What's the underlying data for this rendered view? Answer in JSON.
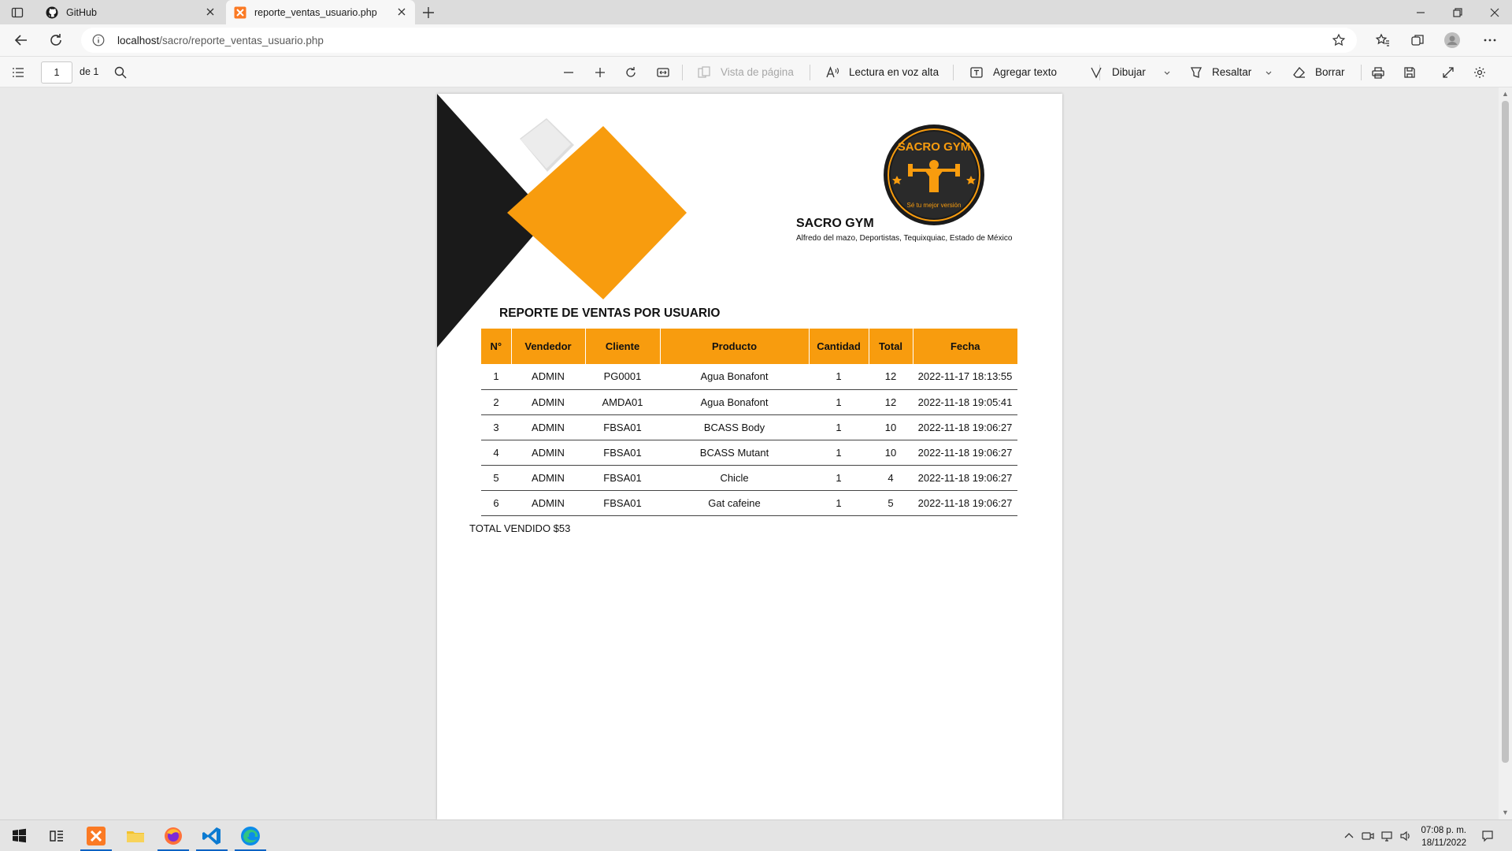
{
  "browser": {
    "tabs": [
      {
        "title": "GitHub",
        "favicon": "github-icon"
      },
      {
        "title": "reporte_ventas_usuario.php",
        "favicon": "xampp-icon"
      }
    ],
    "url_host": "localhost",
    "url_path": "/sacro/reporte_ventas_usuario.php"
  },
  "pdf_toolbar": {
    "page_number": "1",
    "page_of": "de 1",
    "page_view": "Vista de página",
    "read_aloud": "Lectura en voz alta",
    "add_text": "Agregar texto",
    "draw": "Dibujar",
    "highlight": "Resaltar",
    "erase": "Borrar"
  },
  "document": {
    "logo_text": "SACRO GYM",
    "logo_tagline": "Sé tu mejor versión",
    "company_name": "SACRO GYM",
    "company_address": "Alfredo del mazo, Deportistas, Tequixquiac, Estado de México",
    "report_title": "REPORTE DE VENTAS POR USUARIO",
    "columns": [
      "N°",
      "Vendedor",
      "Cliente",
      "Producto",
      "Cantidad",
      "Total",
      "Fecha"
    ],
    "rows": [
      [
        "1",
        "ADMIN",
        "PG0001",
        "Agua Bonafont",
        "1",
        "12",
        "2022-11-17 18:13:55"
      ],
      [
        "2",
        "ADMIN",
        "AMDA01",
        "Agua Bonafont",
        "1",
        "12",
        "2022-11-18 19:05:41"
      ],
      [
        "3",
        "ADMIN",
        "FBSA01",
        "BCASS Body",
        "1",
        "10",
        "2022-11-18 19:06:27"
      ],
      [
        "4",
        "ADMIN",
        "FBSA01",
        "BCASS Mutant",
        "1",
        "10",
        "2022-11-18 19:06:27"
      ],
      [
        "5",
        "ADMIN",
        "FBSA01",
        "Chicle",
        "1",
        "4",
        "2022-11-18 19:06:27"
      ],
      [
        "6",
        "ADMIN",
        "FBSA01",
        "Gat cafeine",
        "1",
        "5",
        "2022-11-18 19:06:27"
      ]
    ],
    "total_label": "TOTAL VENDIDO $53"
  },
  "colors": {
    "accent_orange": "#f89c0e",
    "decor_black": "#1a1a1a",
    "edge_blue": "#0b62c4"
  },
  "taskbar": {
    "time": "07:08 p. m.",
    "date": "18/11/2022",
    "apps": [
      "windows-start-icon",
      "task-view-icon",
      "xampp-icon",
      "file-explorer-icon",
      "firefox-icon",
      "vscode-icon",
      "edge-icon"
    ]
  }
}
